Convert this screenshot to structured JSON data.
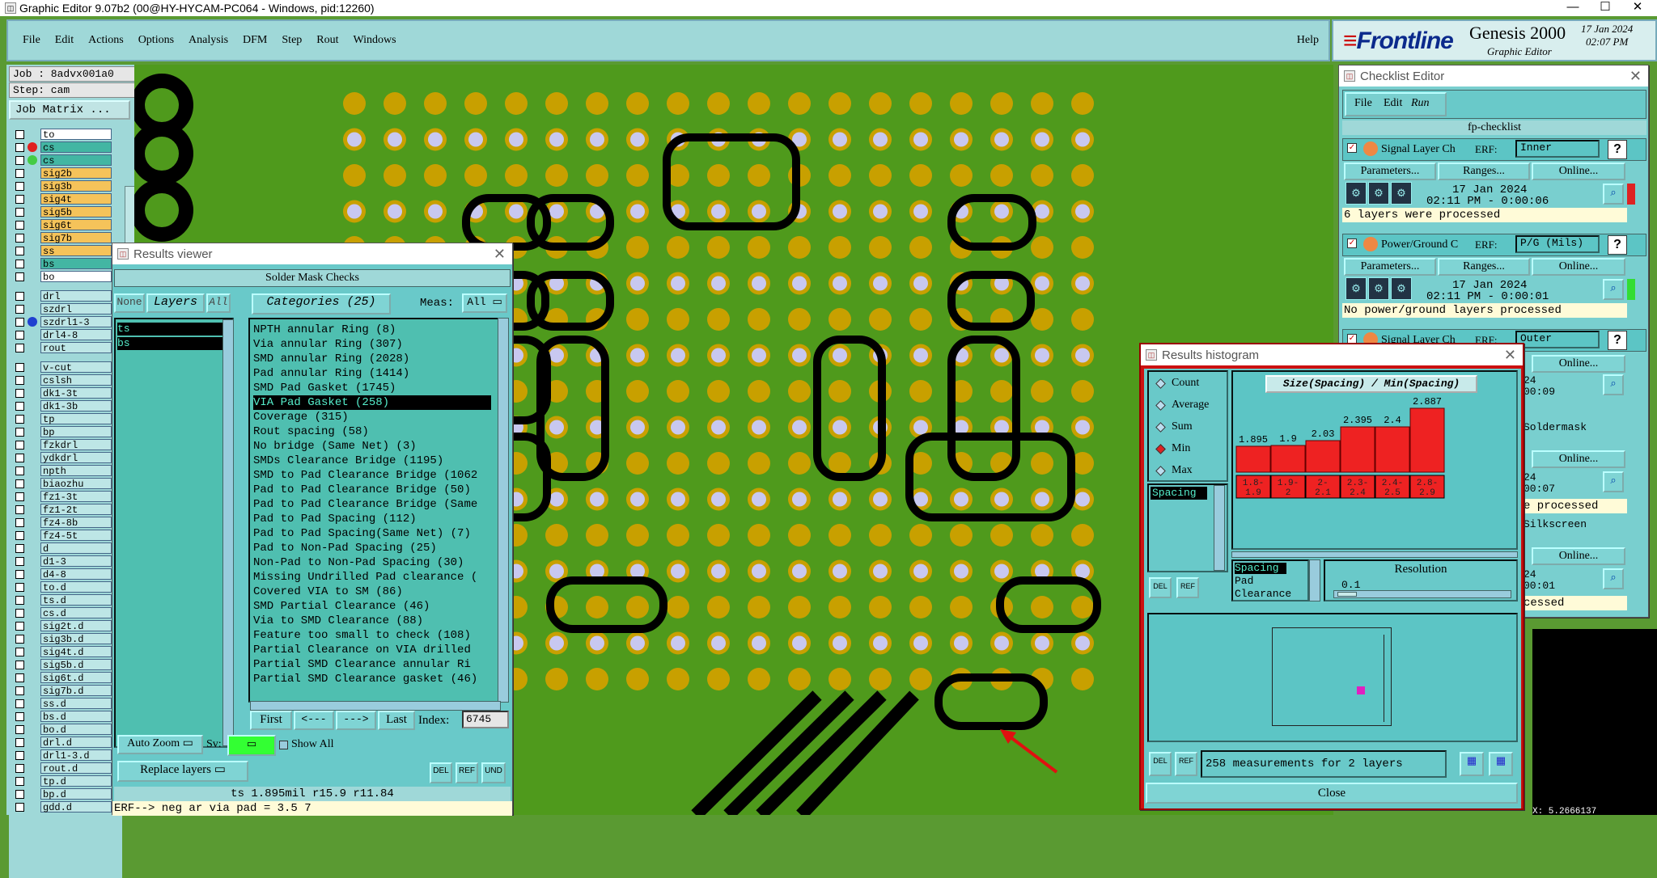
{
  "window_title": "Graphic Editor 9.07b2 (00@HY-HYCAM-PC064 - Windows, pid:12260)",
  "menu": [
    "File",
    "Edit",
    "Actions",
    "Options",
    "Analysis",
    "DFM",
    "Step",
    "Rout",
    "Windows"
  ],
  "help": "Help",
  "logo": {
    "brand": "Frontline",
    "product": "Genesis 2000",
    "sub": "Graphic Editor",
    "date": "17 Jan 2024",
    "time": "02:07 PM"
  },
  "job": "Job : 8advx001a0",
  "step": "Step: cam",
  "job_matrix": "Job Matrix ...",
  "layers": [
    {
      "name": "to",
      "bg": "#ffffff",
      "dot": ""
    },
    {
      "name": "cs",
      "bg": "#43b6a3",
      "dot": "#e02020"
    },
    {
      "name": "cs",
      "bg": "#43b6a3",
      "dot": "#44cc44"
    },
    {
      "name": "sig2b",
      "bg": "#f5c35a",
      "dot": ""
    },
    {
      "name": "sig3b",
      "bg": "#f5c35a",
      "dot": ""
    },
    {
      "name": "sig4t",
      "bg": "#f5c35a",
      "dot": ""
    },
    {
      "name": "sig5b",
      "bg": "#f5c35a",
      "dot": ""
    },
    {
      "name": "sig6t",
      "bg": "#f5c35a",
      "dot": ""
    },
    {
      "name": "sig7b",
      "bg": "#f5c35a",
      "dot": ""
    },
    {
      "name": "ss",
      "bg": "#f5c35a",
      "dot": ""
    },
    {
      "name": "bs",
      "bg": "#43b6a3",
      "dot": ""
    },
    {
      "name": "bo",
      "bg": "#ffffff",
      "dot": ""
    },
    {
      "name": "drl",
      "bg": "#bde6e6",
      "dot": ""
    },
    {
      "name": "szdrl",
      "bg": "#bde6e6",
      "dot": ""
    },
    {
      "name": "szdrl1-3",
      "bg": "#bde6e6",
      "dot": "#2040d0"
    },
    {
      "name": "drl4-8",
      "bg": "#bde6e6",
      "dot": ""
    },
    {
      "name": "rout",
      "bg": "#bde6e6",
      "dot": ""
    },
    {
      "name": "v-cut",
      "bg": "#bde6e6",
      "dot": ""
    },
    {
      "name": "cslsh",
      "bg": "#bde6e6",
      "dot": ""
    },
    {
      "name": "dk1-3t",
      "bg": "#bde6e6",
      "dot": ""
    },
    {
      "name": "dk1-3b",
      "bg": "#bde6e6",
      "dot": ""
    },
    {
      "name": "tp",
      "bg": "#bde6e6",
      "dot": ""
    },
    {
      "name": "bp",
      "bg": "#bde6e6",
      "dot": ""
    },
    {
      "name": "fzkdrl",
      "bg": "#bde6e6",
      "dot": ""
    },
    {
      "name": "ydkdrl",
      "bg": "#bde6e6",
      "dot": ""
    },
    {
      "name": "npth",
      "bg": "#bde6e6",
      "dot": ""
    },
    {
      "name": "biaozhu",
      "bg": "#bde6e6",
      "dot": ""
    },
    {
      "name": "fz1-3t",
      "bg": "#bde6e6",
      "dot": ""
    },
    {
      "name": "fz1-2t",
      "bg": "#bde6e6",
      "dot": ""
    },
    {
      "name": "fz4-8b",
      "bg": "#bde6e6",
      "dot": ""
    },
    {
      "name": "fz4-5t",
      "bg": "#bde6e6",
      "dot": ""
    },
    {
      "name": "d",
      "bg": "#bde6e6",
      "dot": ""
    },
    {
      "name": "d1-3",
      "bg": "#bde6e6",
      "dot": ""
    },
    {
      "name": "d4-8",
      "bg": "#bde6e6",
      "dot": ""
    },
    {
      "name": "to.d",
      "bg": "#bde6e6",
      "dot": ""
    },
    {
      "name": "ts.d",
      "bg": "#bde6e6",
      "dot": ""
    },
    {
      "name": "cs.d",
      "bg": "#bde6e6",
      "dot": ""
    },
    {
      "name": "sig2t.d",
      "bg": "#bde6e6",
      "dot": ""
    },
    {
      "name": "sig3b.d",
      "bg": "#bde6e6",
      "dot": ""
    },
    {
      "name": "sig4t.d",
      "bg": "#bde6e6",
      "dot": ""
    },
    {
      "name": "sig5b.d",
      "bg": "#bde6e6",
      "dot": ""
    },
    {
      "name": "sig6t.d",
      "bg": "#bde6e6",
      "dot": ""
    },
    {
      "name": "sig7b.d",
      "bg": "#bde6e6",
      "dot": ""
    },
    {
      "name": "ss.d",
      "bg": "#bde6e6",
      "dot": ""
    },
    {
      "name": "bs.d",
      "bg": "#bde6e6",
      "dot": ""
    },
    {
      "name": "bo.d",
      "bg": "#bde6e6",
      "dot": ""
    },
    {
      "name": "drl.d",
      "bg": "#bde6e6",
      "dot": ""
    },
    {
      "name": "drl1-3.d",
      "bg": "#bde6e6",
      "dot": ""
    },
    {
      "name": "rout.d",
      "bg": "#bde6e6",
      "dot": ""
    },
    {
      "name": "tp.d",
      "bg": "#bde6e6",
      "dot": ""
    },
    {
      "name": "bp.d",
      "bg": "#bde6e6",
      "dot": ""
    },
    {
      "name": "gdd.d",
      "bg": "#bde6e6",
      "dot": ""
    }
  ],
  "results_viewer": {
    "title": "Results viewer",
    "header": "Solder Mask Checks",
    "tab_none": "None",
    "tab_layers": "Layers",
    "tab_all": "All",
    "categories_label": "Categories (25)",
    "meas_label": "Meas:",
    "meas_value": "All",
    "layers": [
      "ts",
      "bs"
    ],
    "categories": [
      "NPTH annular Ring (8)",
      "Via annular Ring (307)",
      "SMD annular Ring (2028)",
      "Pad annular Ring (1414)",
      "SMD Pad Gasket (1745)",
      "VIA Pad Gasket (258)",
      "Coverage (315)",
      "Rout spacing (58)",
      "No bridge (Same Net) (3)",
      "SMDs Clearance Bridge (1195)",
      "SMD to Pad Clearance Bridge (1062",
      "Pad to Pad Clearance Bridge (50)",
      "Pad to Pad Clearance Bridge (Same",
      "Pad to Pad Spacing (112)",
      "Pad to Pad Spacing(Same Net) (7)",
      "Pad to Non-Pad Spacing (25)",
      "Non-Pad to Non-Pad Spacing (30)",
      "Missing Undrilled Pad clearance (",
      "Covered VIA to SM (86)",
      "SMD Partial Clearance (46)",
      "Via to SMD Clearance (88)",
      "Feature too small to check (108)",
      "Partial Clearance on VIA drilled",
      "Partial SMD Clearance annular Ri",
      "Partial SMD Clearance gasket (46)"
    ],
    "selected_category": "VIA Pad Gasket (258)",
    "first": "First",
    "prev": "<---",
    "next": "--->",
    "last": "Last",
    "index_label": "Index:",
    "index_value": "6745",
    "auto_zoom": "Auto Zoom",
    "sv_label": "Sv:",
    "show_all": "Show All",
    "replace_layers": "Replace layers",
    "status": "ts 1.895mil  r15.9  r11.84",
    "erf_line": "ERF--> neg ar via pad = 3.5 7"
  },
  "histogram": {
    "title": "Results histogram",
    "options": [
      "Count",
      "Average",
      "Sum",
      "Min",
      "Max"
    ],
    "selected_option": "Min",
    "list_item": "Spacing",
    "chart_title": "Size(Spacing) / Min(Spacing)",
    "chart_data": {
      "type": "bar",
      "categories": [
        "1.8-1.9",
        "1.9-2",
        "2-2.1",
        "2.3-2.4",
        "2.4-2.5",
        "2.8-2.9"
      ],
      "values": [
        1.895,
        1.9,
        2.03,
        2.395,
        2.4,
        2.887
      ],
      "title": "Size(Spacing) / Min(Spacing)",
      "value_labels": [
        "1.895",
        "1.9",
        "2.03",
        "2.395",
        "2.4",
        "2.887"
      ],
      "color": "#ee2222"
    },
    "bins_display": [
      [
        "1.8-",
        "1.9"
      ],
      [
        "1.9-",
        "2"
      ],
      [
        "2-",
        "2.1"
      ],
      [
        "2.3-",
        "2.4"
      ],
      [
        "2.4-",
        "2.5"
      ],
      [
        "2.8-",
        "2.9"
      ]
    ],
    "attrs": [
      "Spacing",
      "Pad",
      "Clearance"
    ],
    "resolution_label": "Resolution",
    "resolution_value": "0.1",
    "summary": "258 measurements for 2 layers",
    "close": "Close"
  },
  "checklist": {
    "title": "Checklist Editor",
    "menu": [
      "File",
      "Edit",
      "Run"
    ],
    "name": "fp-checklist",
    "checks": [
      {
        "name": "Signal Layer Ch",
        "erf": "ERF:",
        "value": "Inner",
        "date": "17 Jan 2024",
        "time": "02:11 PM - 0:00:06",
        "status": "6 layers were processed"
      },
      {
        "name": "Power/Ground C",
        "erf": "ERF:",
        "value": "P/G (Mils)",
        "date": "17 Jan 2024",
        "time": "02:11 PM - 0:00:01",
        "status": "No power/ground layers processed"
      },
      {
        "name": "Signal Layer Ch",
        "erf": "ERF:",
        "value": "Outer"
      }
    ],
    "params": "Parameters...",
    "ranges": "Ranges...",
    "online": "Online...",
    "partial_values": [
      "Soldermask",
      "Silkscreen"
    ],
    "partial_times": [
      "24",
      "00:09",
      "24",
      "00:07",
      "24",
      "00:01"
    ],
    "partial_status": [
      "e processed",
      "cessed"
    ]
  },
  "cursor_coords": "X: 5.2666137"
}
